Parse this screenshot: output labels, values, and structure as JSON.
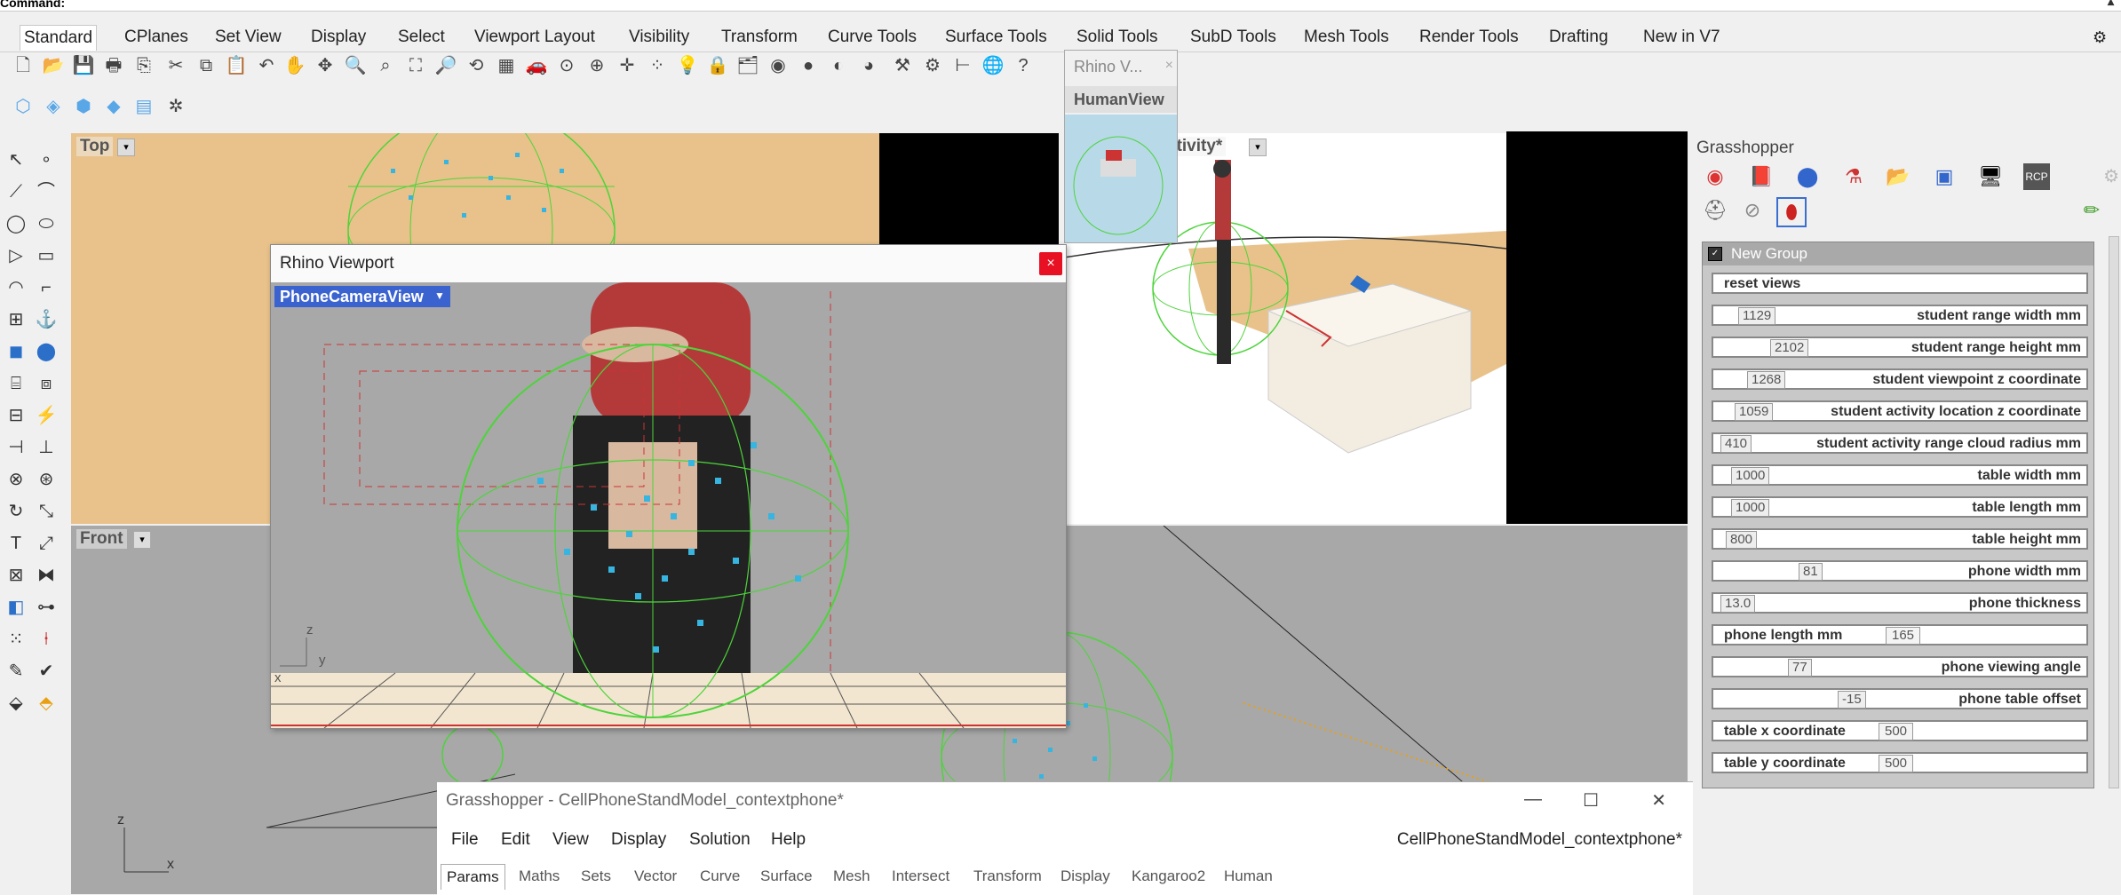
{
  "command": {
    "label": "Command:"
  },
  "menu_tabs": [
    "Standard",
    "CPlanes",
    "Set View",
    "Display",
    "Select",
    "Viewport Layout",
    "Visibility",
    "Transform",
    "Curve Tools",
    "Surface Tools",
    "Solid Tools",
    "SubD Tools",
    "Mesh Tools",
    "Render Tools",
    "Drafting",
    "New in V7"
  ],
  "viewports": {
    "top": "Top",
    "front": "Front",
    "activity": "ctivity*",
    "humanview": "HumanView",
    "rhino_v_tab": "Rhino V..."
  },
  "rhino_viewport_window": {
    "title": "Rhino Viewport",
    "view_name": "PhoneCameraView",
    "close": "×"
  },
  "grasshopper_panel": {
    "title": "Grasshopper",
    "group_name": "New Group",
    "reset_button": "reset views",
    "sliders": [
      {
        "value": "1129",
        "label": "student range width mm"
      },
      {
        "value": "2102",
        "label": "student range height mm"
      },
      {
        "value": "1268",
        "label": "student viewpoint z coordinate"
      },
      {
        "value": "1059",
        "label": "student activity location z coordinate"
      },
      {
        "value": "410",
        "label": "student activity range cloud radius mm"
      },
      {
        "value": "1000",
        "label": "table width mm"
      },
      {
        "value": "1000",
        "label": "table length mm"
      },
      {
        "value": "800",
        "label": "table height mm"
      },
      {
        "value": "81",
        "label": "phone width mm"
      },
      {
        "value": "13.0",
        "label": "phone thickness"
      },
      {
        "value": "165",
        "label": "phone length mm"
      },
      {
        "value": "77",
        "label": "phone viewing angle"
      },
      {
        "value": "-15",
        "label": "phone table offset"
      },
      {
        "value": "500",
        "label": "table x coordinate"
      },
      {
        "value": "500",
        "label": "table y coordinate"
      }
    ]
  },
  "gh_window": {
    "title": "Grasshopper - CellPhoneStandModel_contextphone*",
    "menus": [
      "File",
      "Edit",
      "View",
      "Display",
      "Solution",
      "Help"
    ],
    "filename": "CellPhoneStandModel_contextphone*",
    "categories": [
      "Params",
      "Maths",
      "Sets",
      "Vector",
      "Curve",
      "Surface",
      "Mesh",
      "Intersect",
      "Transform",
      "Display",
      "Kangaroo2",
      "Human"
    ]
  },
  "axes": {
    "x": "x",
    "y": "y",
    "z": "z"
  },
  "colors": {
    "viewport_tan": "#e8c28a",
    "viewport_gray": "#a8a8a8",
    "wire_green": "#4cd43a",
    "points_cyan": "#36b5e0",
    "highlight_blue": "#3b63d0"
  }
}
